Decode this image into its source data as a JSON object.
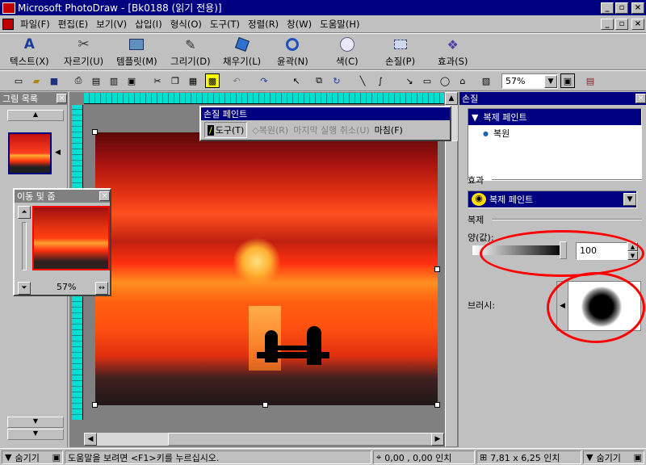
{
  "title": {
    "app": "Microsoft PhotoDraw",
    "doc": "[Bk0188 (읽기 전용)]"
  },
  "menu": [
    "파일(F)",
    "편집(E)",
    "보기(V)",
    "삽입(I)",
    "형식(O)",
    "도구(T)",
    "정렬(R)",
    "창(W)",
    "도움말(H)"
  ],
  "bigbar": [
    "텍스트(X)",
    "자르기(U)",
    "템플릿(M)",
    "그리기(D)",
    "채우기(L)",
    "윤곽(N)",
    "색(C)",
    "손질(P)",
    "효과(S)"
  ],
  "zoom": "57%",
  "left_panel": {
    "title": "그림 목록"
  },
  "move_zoom": {
    "title": "이동 및 줌",
    "zoom": "57%"
  },
  "clone_toolbar": {
    "title": "손질 페인트",
    "buttons": [
      "도구(T)",
      "복원(R)",
      "마지막 실행 취소(U)",
      "마침(F)"
    ]
  },
  "right_panel": {
    "title": "손질",
    "tree": {
      "parent": "복제 페인트",
      "child": "복원"
    },
    "effect_label": "효과",
    "effect_value": "복제 페인트",
    "clone_label": "복제",
    "amount_label": "양(값):",
    "amount_value": "100",
    "amount_fraction": 1.0,
    "brush_label": "브러시:"
  },
  "status": {
    "hide_left": "숨기기",
    "help": "도움말을 보려면 <F1>키를 누르십시오.",
    "coords": "0,00 , 0,00 인치",
    "size": "7,81 x 6,25 인치",
    "hide_right": "숨기기"
  }
}
